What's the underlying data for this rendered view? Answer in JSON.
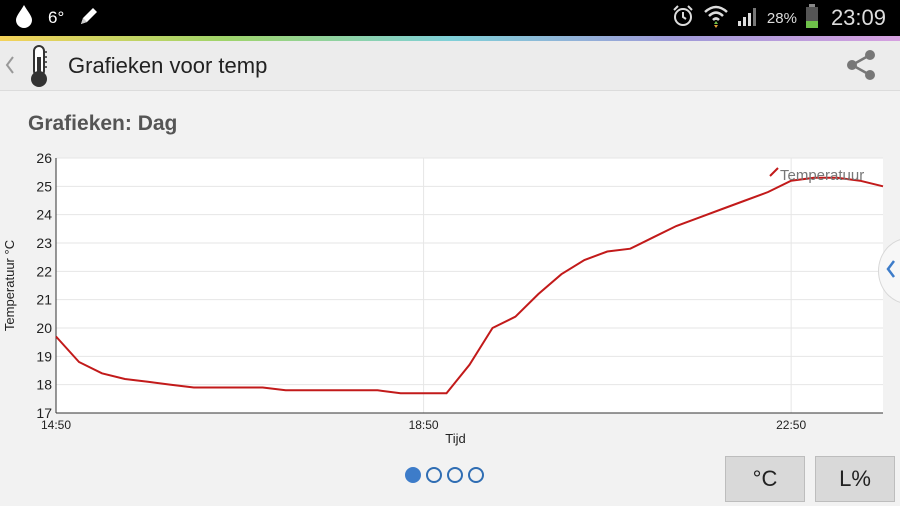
{
  "status_bar": {
    "temperature": "6°",
    "battery_percent": "28%",
    "time": "23:09"
  },
  "action_bar": {
    "title": "Grafieken voor temp"
  },
  "chart_data": {
    "type": "line",
    "title": "Grafieken: Dag",
    "xlabel": "Tijd",
    "ylabel": "Temperatuur °C",
    "x_ticks": [
      "14:50",
      "18:50",
      "22:50"
    ],
    "y_ticks": [
      17,
      18,
      19,
      20,
      21,
      22,
      23,
      24,
      25,
      26
    ],
    "ylim": [
      17,
      26
    ],
    "xlim_hours": [
      14.833,
      23.833
    ],
    "grid": true,
    "legend_position": "top-right",
    "line_color": "#c21a1a",
    "series": [
      {
        "name": "Temperatuur",
        "x_hours": [
          14.833,
          15.083,
          15.333,
          15.583,
          15.833,
          16.083,
          16.333,
          16.583,
          16.833,
          17.083,
          17.333,
          17.583,
          17.833,
          18.083,
          18.333,
          18.583,
          18.833,
          19.083,
          19.333,
          19.583,
          19.833,
          20.083,
          20.333,
          20.583,
          20.833,
          21.083,
          21.333,
          21.583,
          21.833,
          22.083,
          22.333,
          22.583,
          22.833,
          23.083,
          23.333,
          23.583,
          23.833
        ],
        "values": [
          19.7,
          18.8,
          18.4,
          18.2,
          18.1,
          18.0,
          17.9,
          17.9,
          17.9,
          17.9,
          17.8,
          17.8,
          17.8,
          17.8,
          17.8,
          17.7,
          17.7,
          17.7,
          18.7,
          20.0,
          20.4,
          21.2,
          21.9,
          22.4,
          22.7,
          22.8,
          23.2,
          23.6,
          23.9,
          24.2,
          24.5,
          24.8,
          25.2,
          25.3,
          25.3,
          25.2,
          25.0
        ]
      }
    ]
  },
  "pager": {
    "pages": 4,
    "active_index": 0
  },
  "buttons": {
    "celsius_label": "°C",
    "humidity_label": "L%"
  }
}
